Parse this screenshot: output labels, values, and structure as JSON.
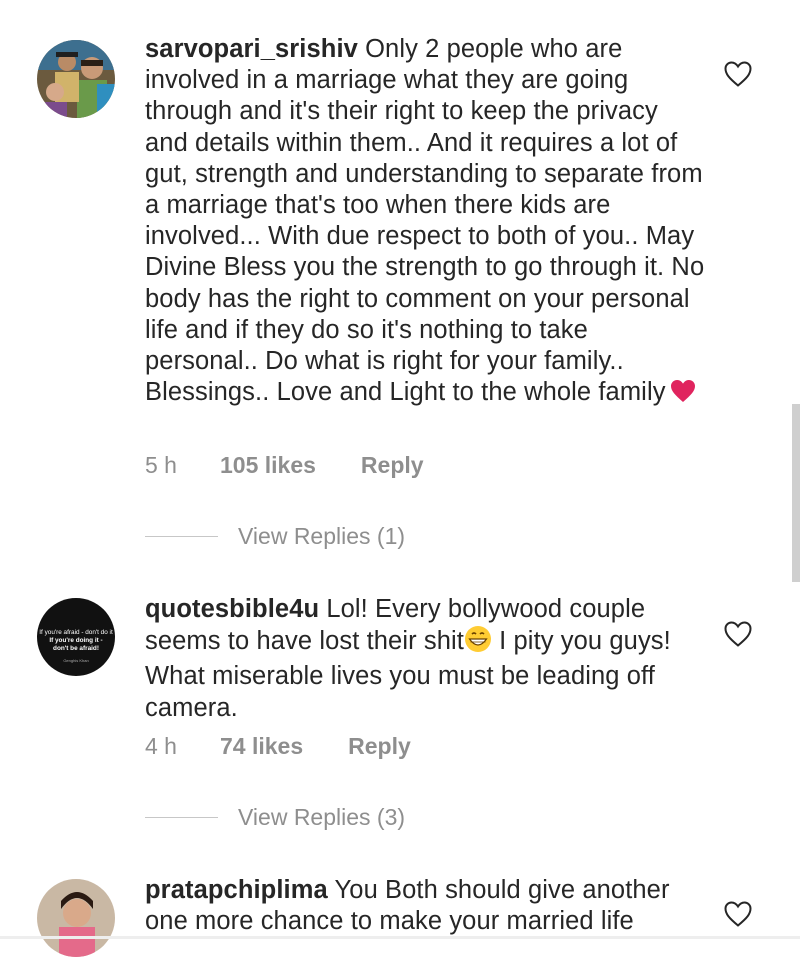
{
  "comments": [
    {
      "username": "sarvopari_srishiv",
      "text": "Only 2 people who are involved in a marriage what they are going through and it's their right to keep the privacy and details within them.. And it requires a lot of gut, strength and understanding to separate from a marriage that's too when there kids are involved... With due respect to both of you.. May Divine Bless you the strength to go through it. No body has the right to comment on your personal life and if they do so it's nothing to take personal.. Do what is right for your family.. Blessings.. Love and Light to the whole family",
      "time": "5 h",
      "likes": "105 likes",
      "reply": "Reply",
      "view_replies": "View Replies (1)"
    },
    {
      "username": "quotesbible4u",
      "text": "Lol! Every bollywood couple seems to have lost their shit",
      "text_after": " I pity you guys! What miserable lives you must be leading off camera.",
      "time": "4 h",
      "likes": "74 likes",
      "reply": "Reply",
      "view_replies": "View Replies (3)",
      "avatar_text": {
        "line1": "If you're afraid - don't do it",
        "line2": "If you're doing it -",
        "line3": "don't be afraid!",
        "line4": "Genghis Khan"
      }
    },
    {
      "username": "pratapchiplima",
      "text": "You Both should give another one more chance to make your married life"
    }
  ],
  "icons": {
    "like": "heart-outline-icon",
    "heart_emoji": "red-heart-emoji",
    "grin_emoji": "grinning-face-emoji"
  },
  "colors": {
    "text": "#262626",
    "secondary": "#8e8e8e",
    "heart_red": "#e0245e"
  }
}
